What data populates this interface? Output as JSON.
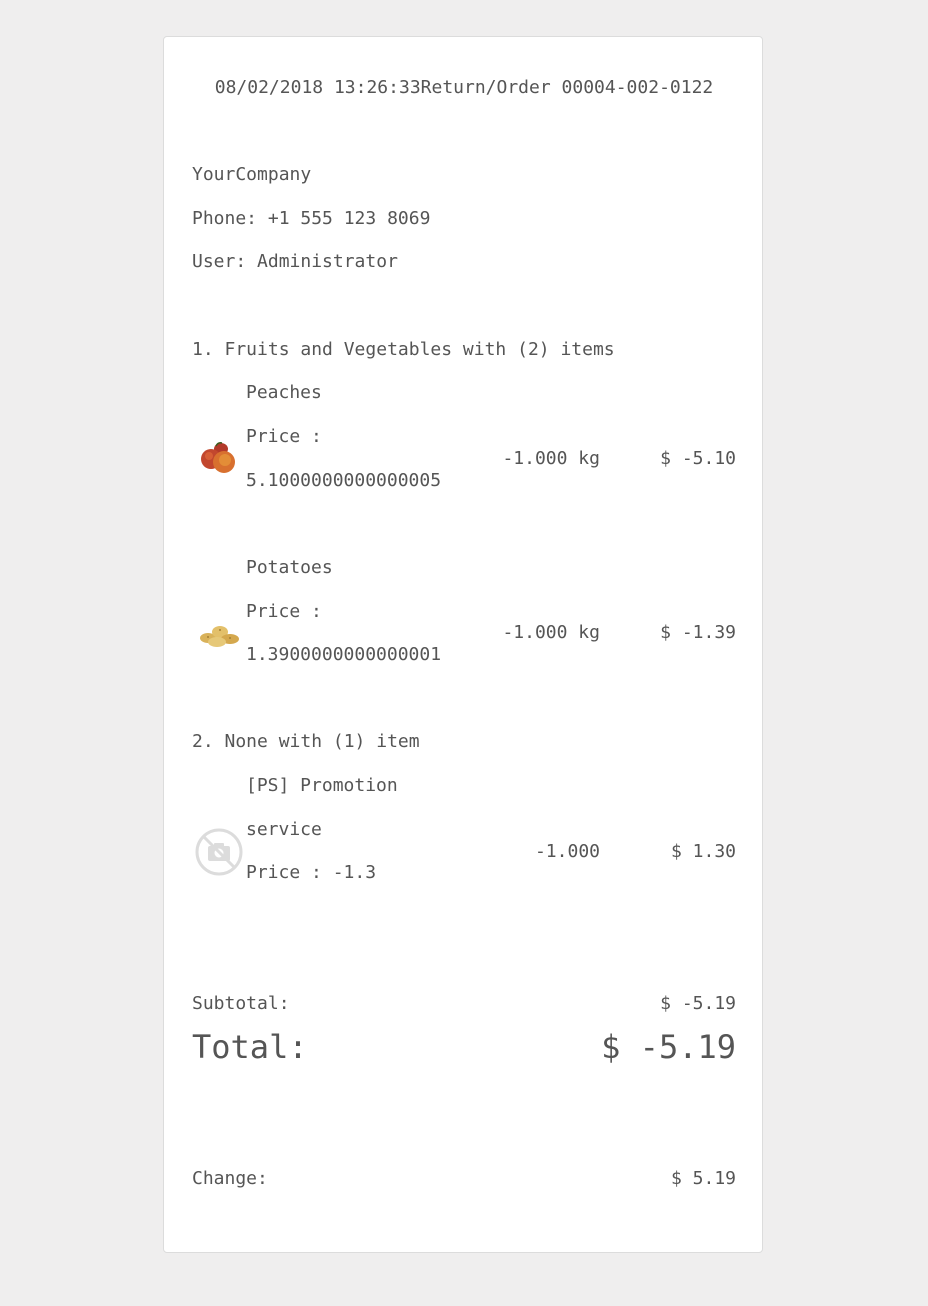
{
  "header": {
    "datetime_order": "08/02/2018 13:26:33Return/Order 00004-002-0122"
  },
  "company": {
    "name": "YourCompany",
    "phone": "Phone: +1 555 123 8069",
    "user": "User: Administrator"
  },
  "categories": [
    {
      "title": "1. Fruits and Vegetables with (2) items",
      "items": [
        {
          "name": "Peaches",
          "price_label": "Price :",
          "price_value": "5.1000000000000005",
          "qty": "-1.000 kg",
          "amount": "$ -5.10",
          "icon": "peaches-icon"
        },
        {
          "name": "Potatoes",
          "price_label": "Price :",
          "price_value": "1.3900000000000001",
          "qty": "-1.000 kg",
          "amount": "$ -1.39",
          "icon": "potatoes-icon"
        }
      ]
    },
    {
      "title": "2. None with (1) item",
      "items": [
        {
          "name": "[PS] Promotion",
          "name_line2": "service",
          "price_text": "Price : -1.3",
          "qty": "-1.000",
          "amount": "$ 1.30",
          "icon": "no-image-icon"
        }
      ]
    }
  ],
  "summary": {
    "subtotal_label": "Subtotal:",
    "subtotal_amount": "$ -5.19",
    "total_label": "Total:",
    "total_amount": "$ -5.19",
    "change_label": "Change:",
    "change_amount": "$ 5.19"
  }
}
